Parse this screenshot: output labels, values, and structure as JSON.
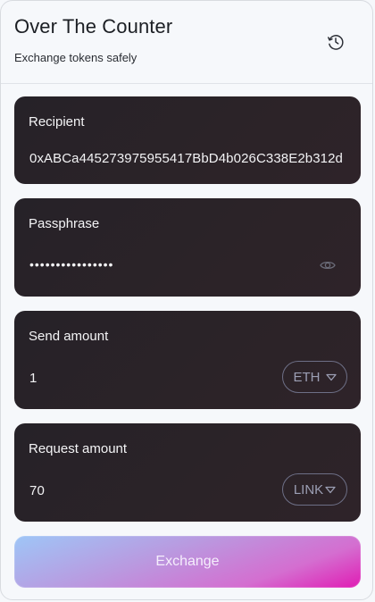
{
  "header": {
    "title": "Over The Counter",
    "subtitle": "Exchange tokens safely",
    "history_icon": "clock-history-icon"
  },
  "recipient": {
    "label": "Recipient",
    "value": "0xABCa445273975955417BbD4b026C338E2b312d"
  },
  "passphrase": {
    "label": "Passphrase",
    "value": "••••••••••••••••",
    "toggle_icon": "eye-icon"
  },
  "send": {
    "label": "Send amount",
    "value": "1",
    "token": "ETH",
    "dropdown_icon": "triangle-down-icon"
  },
  "request": {
    "label": "Request amount",
    "value": "70",
    "token": "LINK",
    "dropdown_icon": "triangle-down-icon"
  },
  "exchange": {
    "label": "Exchange"
  },
  "colors": {
    "panel_bg": "#2a2328",
    "accent_start": "#9ec6f7",
    "accent_end": "#e01cb4",
    "token_border": "#6d6f86"
  }
}
